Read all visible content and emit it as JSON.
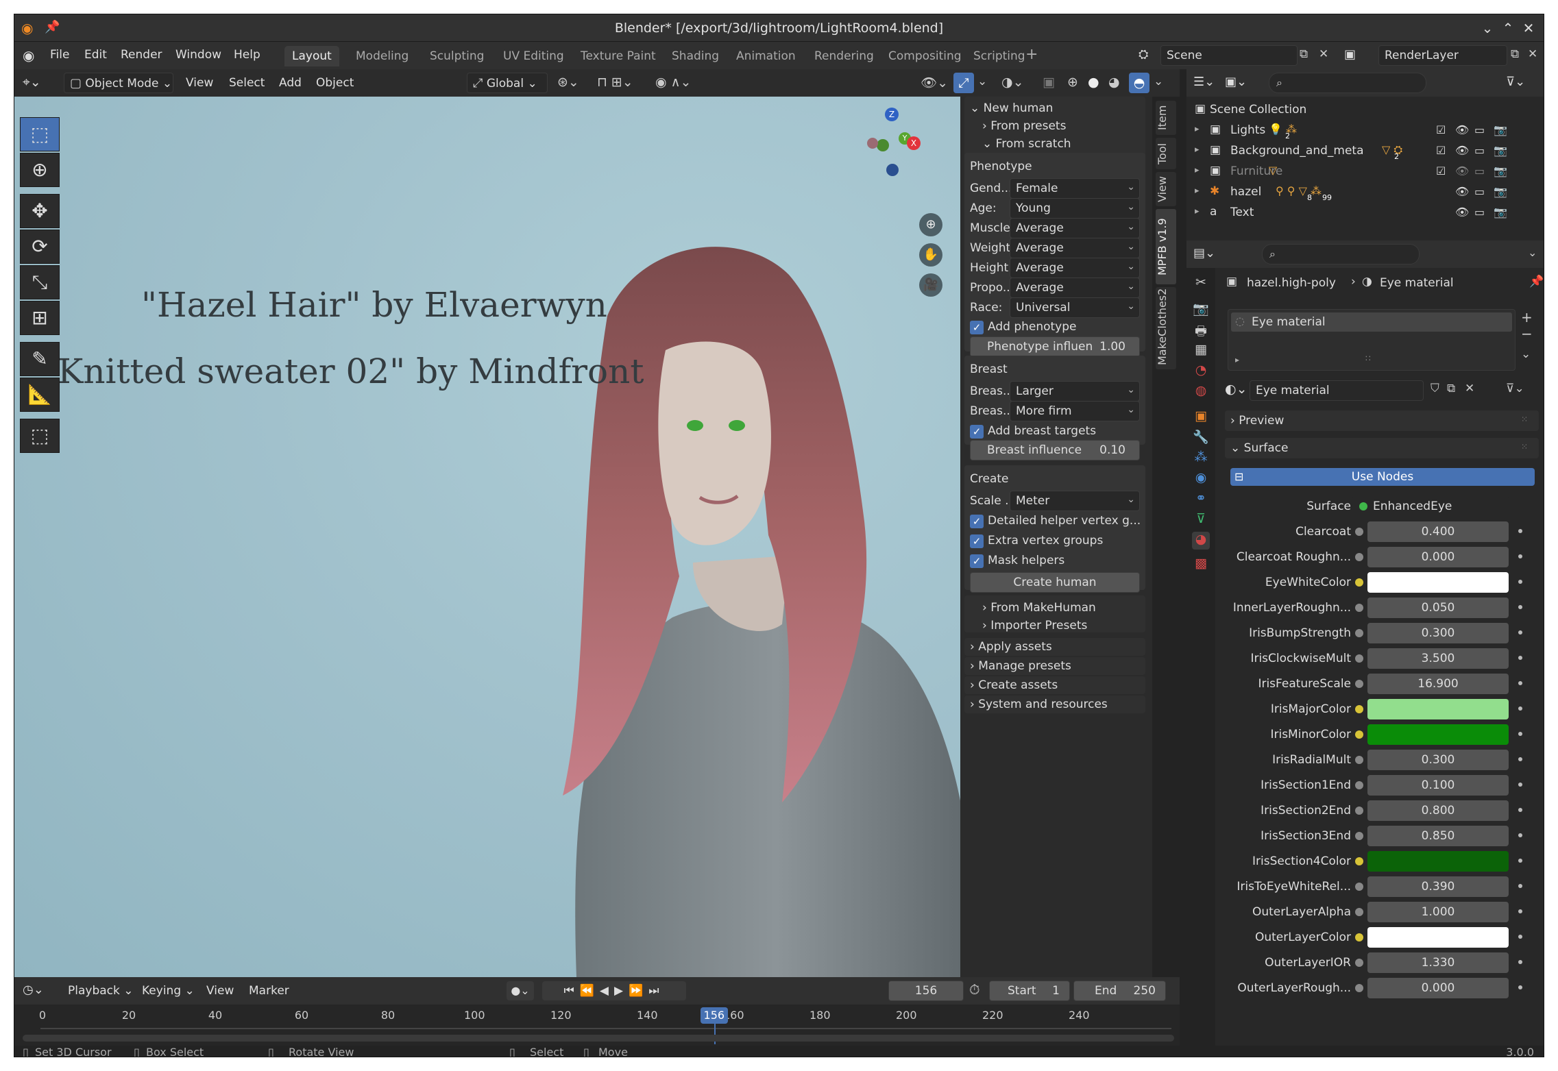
{
  "window": {
    "title": "Blender* [/export/3d/lightroom/LightRoom4.blend]"
  },
  "menu": [
    "File",
    "Edit",
    "Render",
    "Window",
    "Help"
  ],
  "workspaces": [
    "Layout",
    "Modeling",
    "Sculpting",
    "UV Editing",
    "Texture Paint",
    "Shading",
    "Animation",
    "Rendering",
    "Compositing",
    "Scripting"
  ],
  "scene": {
    "scene_label": "Scene",
    "view_layer": "RenderLayer"
  },
  "header3d": {
    "mode": "Object Mode",
    "items": [
      "View",
      "Select",
      "Add",
      "Object"
    ],
    "orientation": "Global"
  },
  "viewport": {
    "credit1": "\"Hazel Hair\" by Elvaerwyn",
    "credit2": "\"Knitted sweater 02\" by Mindfront",
    "gizmo": {
      "z": "Z",
      "y": "Y",
      "x": "X"
    }
  },
  "npanel": {
    "new_human": "New human",
    "from_presets": "From presets",
    "from_scratch": "From scratch",
    "phenotype": {
      "title": "Phenotype",
      "rows": [
        {
          "label": "Gend...",
          "value": "Female"
        },
        {
          "label": "Age:",
          "value": "Young"
        },
        {
          "label": "Muscle:",
          "value": "Average"
        },
        {
          "label": "Weight:",
          "value": "Average"
        },
        {
          "label": "Height:",
          "value": "Average"
        },
        {
          "label": "Propo...",
          "value": "Average"
        },
        {
          "label": "Race:",
          "value": "Universal"
        }
      ],
      "add_label": "Add phenotype",
      "influence_label": "Phenotype influen",
      "influence_value": "1.00"
    },
    "breast": {
      "title": "Breast",
      "rows": [
        {
          "label": "Breas...",
          "value": "Larger"
        },
        {
          "label": "Breas...",
          "value": "More firm"
        }
      ],
      "add_label": "Add breast targets",
      "influence_label": "Breast influence",
      "influence_value": "0.10"
    },
    "create": {
      "title": "Create",
      "scale_label": "Scale ...",
      "scale_value": "Meter",
      "check1": "Detailed helper vertex g...",
      "check2": "Extra vertex groups",
      "check3": "Mask helpers",
      "button": "Create human"
    },
    "from_makehuman": "From MakeHuman",
    "importer_presets": "Importer Presets",
    "apply_assets": "Apply assets",
    "manage_presets": "Manage presets",
    "create_assets": "Create assets",
    "system": "System and resources"
  },
  "vtabs": [
    "Item",
    "Tool",
    "View",
    "MPFB v1.9",
    "MakeClothes2"
  ],
  "timeline": {
    "menus": [
      "Playback",
      "Keying",
      "View",
      "Marker"
    ],
    "current_frame": "156",
    "start_label": "Start",
    "start": "1",
    "end_label": "End",
    "end": "250",
    "ticks": [
      "0",
      "20",
      "40",
      "60",
      "80",
      "100",
      "120",
      "140",
      "160",
      "180",
      "200",
      "220",
      "240"
    ],
    "playhead": "156",
    "playhead_frame": 156
  },
  "status": {
    "set_cursor": "Set 3D Cursor",
    "box_select": "Box Select",
    "rotate": "Rotate View",
    "select": "Select",
    "move": "Move",
    "version": "3.0.0"
  },
  "outliner": {
    "root": "Scene Collection",
    "items": [
      {
        "name": "Lights"
      },
      {
        "name": "Background_and_meta"
      },
      {
        "name": "Furniture"
      },
      {
        "name": "hazel"
      },
      {
        "name": "Text"
      }
    ],
    "badges": {
      "lights": "2",
      "bg": "2",
      "hazel_a": "8",
      "hazel_b": "99"
    }
  },
  "properties": {
    "object": "hazel.high-poly",
    "material": "Eye material",
    "slot": "Eye material",
    "mat_name": "Eye material",
    "preview": "Preview",
    "surface_panel": "Surface",
    "use_nodes": "Use Nodes",
    "surface_label": "Surface",
    "surface_value": "EnhancedEye",
    "rows": [
      {
        "label": "Clearcoat",
        "value": "0.400"
      },
      {
        "label": "Clearcoat Roughn...",
        "value": "0.000"
      },
      {
        "label": "EyeWhiteColor",
        "color": "#ffffff"
      },
      {
        "label": "InnerLayerRoughn...",
        "value": "0.050"
      },
      {
        "label": "IrisBumpStrength",
        "value": "0.300"
      },
      {
        "label": "IrisClockwiseMult",
        "value": "3.500"
      },
      {
        "label": "IrisFeatureScale",
        "value": "16.900"
      },
      {
        "label": "IrisMajorColor",
        "color": "#92de8d"
      },
      {
        "label": "IrisMinorColor",
        "color": "#0a8c08"
      },
      {
        "label": "IrisRadialMult",
        "value": "0.300"
      },
      {
        "label": "IrisSection1End",
        "value": "0.100"
      },
      {
        "label": "IrisSection2End",
        "value": "0.800"
      },
      {
        "label": "IrisSection3End",
        "value": "0.850"
      },
      {
        "label": "IrisSection4Color",
        "color": "#0b6308"
      },
      {
        "label": "IrisToEyeWhiteRel...",
        "value": "0.390"
      },
      {
        "label": "OuterLayerAlpha",
        "value": "1.000"
      },
      {
        "label": "OuterLayerColor",
        "color": "#ffffff"
      },
      {
        "label": "OuterLayerIOR",
        "value": "1.330"
      },
      {
        "label": "OuterLayerRough...",
        "value": "0.000"
      }
    ]
  },
  "colors": {
    "accent": "#4772b3",
    "header": "#303030",
    "panel": "#2b2b2b"
  }
}
